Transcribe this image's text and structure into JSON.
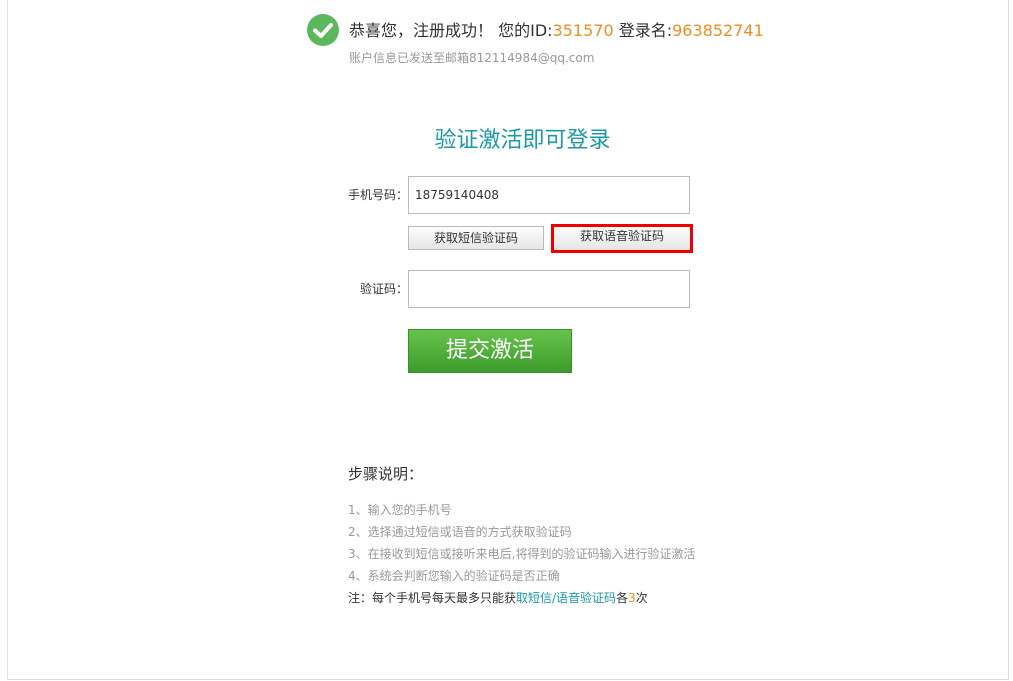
{
  "header": {
    "congrats": "恭喜您，注册成功！",
    "id_label": "您的ID:",
    "id_value": "351570",
    "login_label": "登录名:",
    "login_value": "963852741",
    "email_notice": "账户信息已发送至邮箱812114984@qq.com"
  },
  "form": {
    "title": "验证激活即可登录",
    "phone_label": "手机号码：",
    "phone_value": "18759140408",
    "sms_button": "获取短信验证码",
    "voice_button": "获取语音验证码",
    "code_label": "验证码：",
    "code_value": "",
    "submit_button": "提交激活"
  },
  "steps": {
    "title": "步骤说明：",
    "items": [
      "1、输入您的手机号",
      "2、选择通过短信或语音的方式获取验证码",
      "3、在接收到短信或接听来电后,将得到的验证码输入进行验证激活",
      "4、系统会判断您输入的验证码是否正确"
    ],
    "note_prefix": "注：每个手机号每天最多只能获",
    "note_highlight": "取短信/语音验证码",
    "note_mid": "各",
    "note_count": "3",
    "note_suffix": "次"
  },
  "colors": {
    "accent_teal": "#1b9aa6",
    "accent_orange": "#f08c1e",
    "success_green": "#5cb85c",
    "submit_green": "#4caf35",
    "highlight_red": "#ee0000"
  }
}
